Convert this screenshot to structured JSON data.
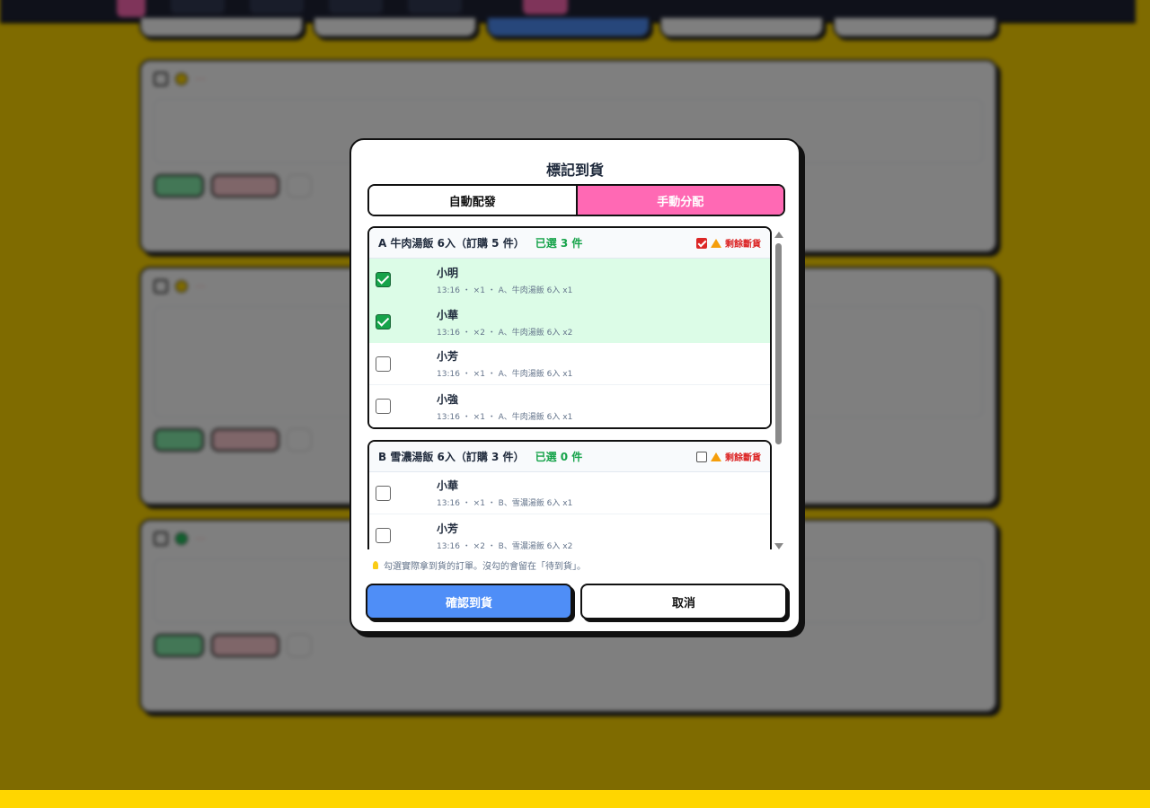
{
  "modal": {
    "title": "標記到貨",
    "tabs": {
      "auto": "自動配發",
      "manual": "手動分配"
    },
    "groups": [
      {
        "name": "A 牛肉湯飯 6入（訂購 5 件）",
        "selected": "已選 3 件",
        "soldout_checked": true,
        "soldout_label": "剩餘斷貨",
        "orders": [
          {
            "name": "小明",
            "meta": "13:16 ・ ×1 ・ A、牛肉湯飯 6入 x1",
            "checked": true
          },
          {
            "name": "小華",
            "meta": "13:16 ・ ×2 ・ A、牛肉湯飯 6入 x2",
            "checked": true
          },
          {
            "name": "小芳",
            "meta": "13:16 ・ ×1 ・ A、牛肉湯飯 6入 x1",
            "checked": false
          },
          {
            "name": "小強",
            "meta": "13:16 ・ ×1 ・ A、牛肉湯飯 6入 x1",
            "checked": false
          }
        ]
      },
      {
        "name": "B 雪濃湯飯 6入（訂購 3 件）",
        "selected": "已選 0 件",
        "soldout_checked": false,
        "soldout_label": "剩餘斷貨",
        "orders": [
          {
            "name": "小華",
            "meta": "13:16 ・ ×1 ・ B、雪濃湯飯 6入 x1",
            "checked": false
          },
          {
            "name": "小芳",
            "meta": "13:16 ・ ×2 ・ B、雪濃湯飯 6入 x2",
            "checked": false
          }
        ]
      }
    ],
    "hint": "勾選實際拿到貨的訂單。沒勾的會留在「待到貨」。",
    "confirm_label": "確認到貨",
    "cancel_label": "取消"
  },
  "colors": {
    "accent_pink": "#ff69b4",
    "confirm_blue": "#4f8ef7",
    "selected_row": "#dcfce7",
    "selected_text": "#16a34a",
    "warning_red": "#dc2626",
    "background_yellow": "#ffd600"
  }
}
